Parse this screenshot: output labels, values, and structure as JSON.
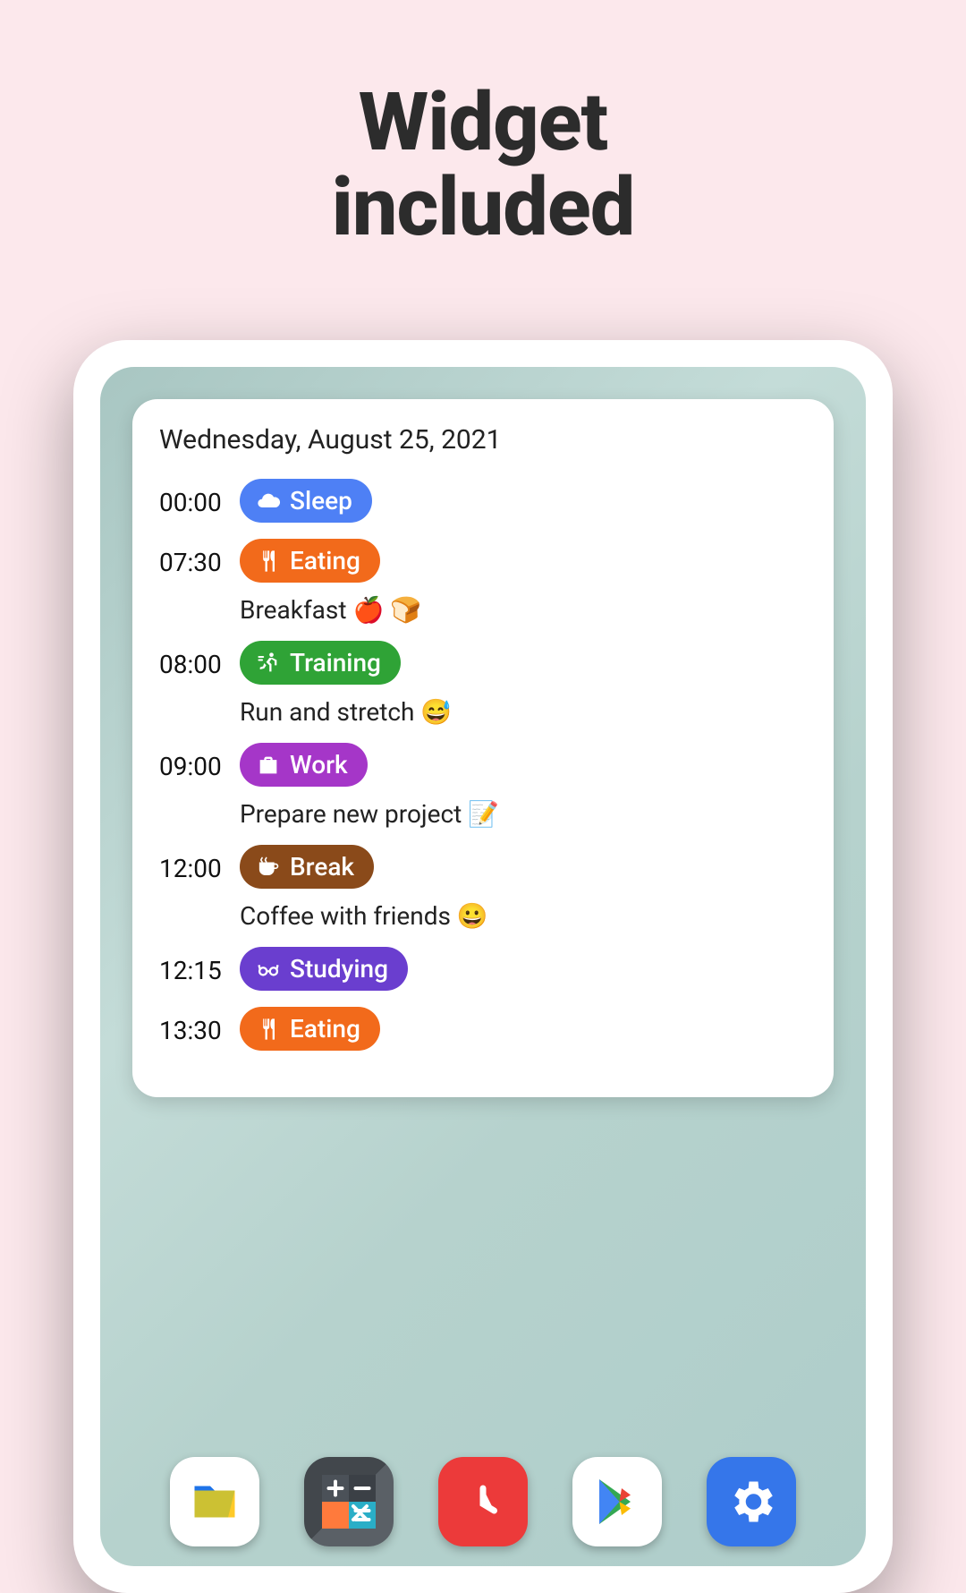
{
  "headline_line1": "Widget",
  "headline_line2": "included",
  "widget": {
    "date": "Wednesday, August 25, 2021",
    "entries": [
      {
        "time": "00:00",
        "label": "Sleep",
        "icon": "cloud",
        "color": "#4e80f5",
        "desc": ""
      },
      {
        "time": "07:30",
        "label": "Eating",
        "icon": "utensils",
        "color": "#f26a1b",
        "desc": "Breakfast 🍎 🍞"
      },
      {
        "time": "08:00",
        "label": "Training",
        "icon": "running",
        "color": "#2fa336",
        "desc": "Run and stretch 😅"
      },
      {
        "time": "09:00",
        "label": "Work",
        "icon": "briefcase",
        "color": "#a536c8",
        "desc": "Prepare new project 📝"
      },
      {
        "time": "12:00",
        "label": "Break",
        "icon": "coffee",
        "color": "#8a4a1a",
        "desc": "Coffee with friends 😀"
      },
      {
        "time": "12:15",
        "label": "Studying",
        "icon": "glasses",
        "color": "#6a3ecf",
        "desc": ""
      },
      {
        "time": "13:30",
        "label": "Eating",
        "icon": "utensils",
        "color": "#f26a1b",
        "desc": ""
      }
    ]
  },
  "dock": [
    {
      "name": "files",
      "icon": "files-icon"
    },
    {
      "name": "calculator",
      "icon": "calculator-icon"
    },
    {
      "name": "clock",
      "icon": "clock-icon"
    },
    {
      "name": "play-store",
      "icon": "play-store-icon"
    },
    {
      "name": "settings",
      "icon": "settings-icon"
    }
  ]
}
